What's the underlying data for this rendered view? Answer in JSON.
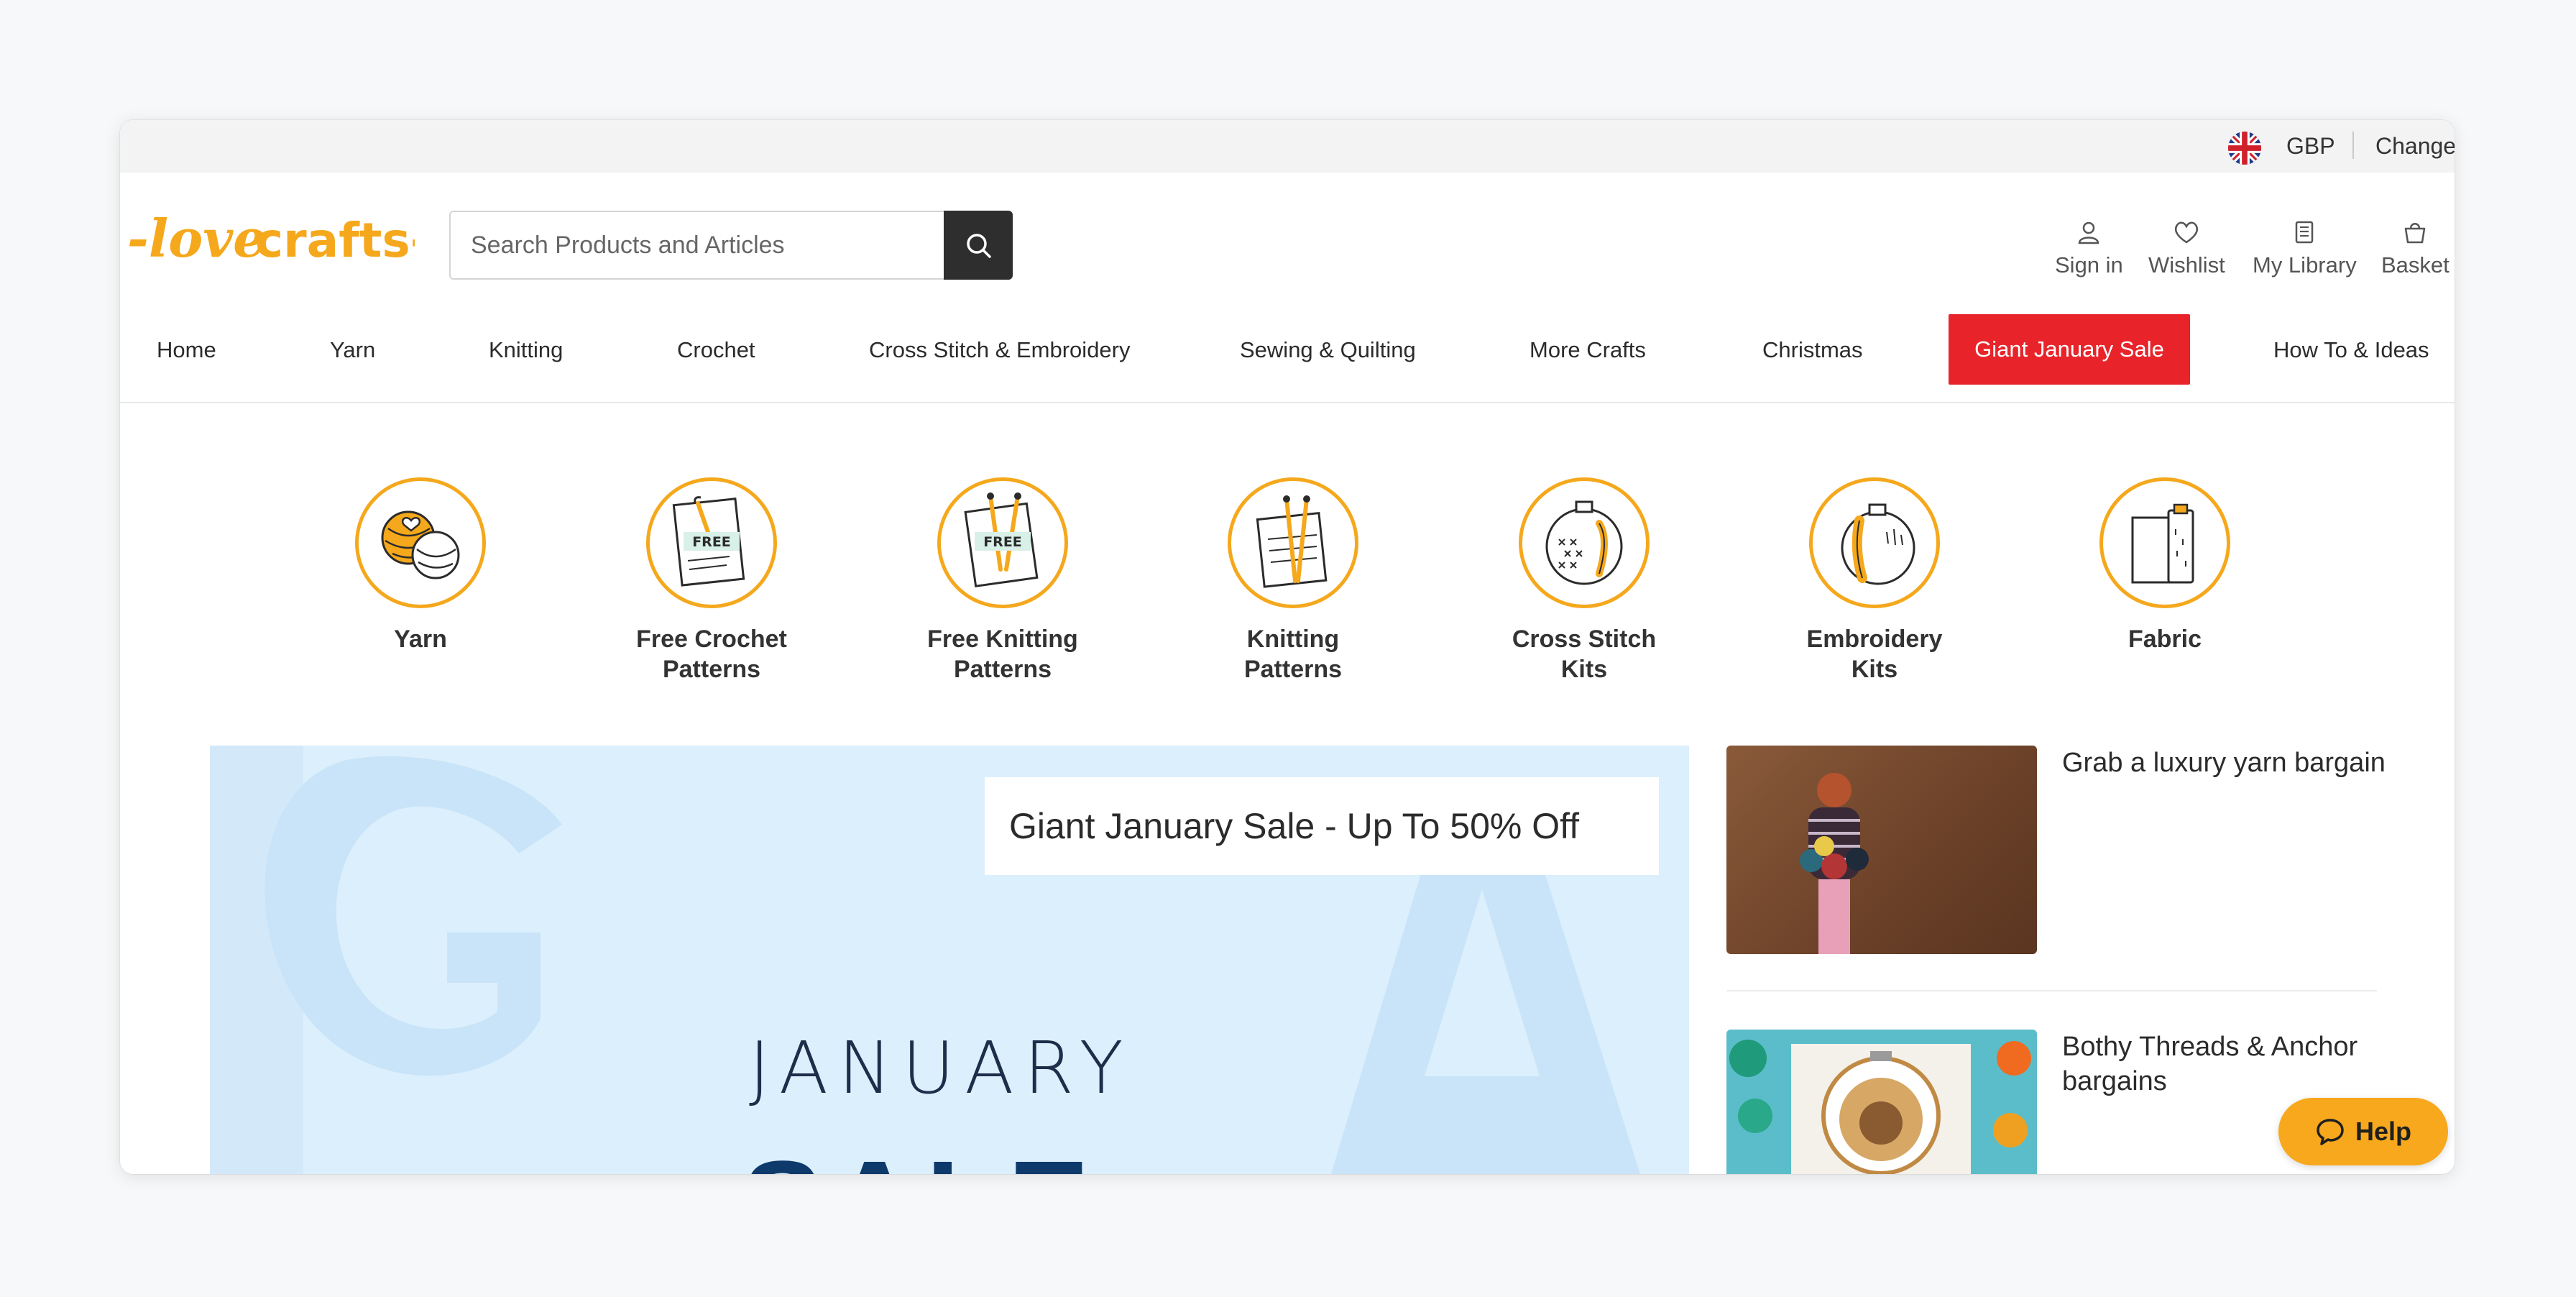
{
  "topbar": {
    "currency": "GBP",
    "change_label": "Change"
  },
  "logo": {
    "text": "-lovecrafts-"
  },
  "search": {
    "placeholder": "Search Products and Articles"
  },
  "header_actions": [
    {
      "label": "Sign in",
      "icon": "user-icon"
    },
    {
      "label": "Wishlist",
      "icon": "heart-icon"
    },
    {
      "label": "My Library",
      "icon": "library-icon"
    },
    {
      "label": "Basket",
      "icon": "basket-icon"
    }
  ],
  "nav": {
    "items": [
      "Home",
      "Yarn",
      "Knitting",
      "Crochet",
      "Cross Stitch & Embroidery",
      "Sewing & Quilting",
      "More Crafts",
      "Christmas",
      "Giant January Sale",
      "How To & Ideas"
    ]
  },
  "categories": [
    {
      "line1": "Yarn",
      "line2": ""
    },
    {
      "line1": "Free Crochet",
      "line2": "Patterns",
      "badge": "FREE"
    },
    {
      "line1": "Free Knitting",
      "line2": "Patterns",
      "badge": "FREE"
    },
    {
      "line1": "Knitting",
      "line2": "Patterns"
    },
    {
      "line1": "Cross Stitch",
      "line2": "Kits"
    },
    {
      "line1": "Embroidery",
      "line2": "Kits"
    },
    {
      "line1": "Fabric",
      "line2": ""
    }
  ],
  "hero": {
    "title": "Giant January Sale - Up To 50% Off",
    "line1": "JANUARY",
    "line2": "SALE"
  },
  "promos": [
    {
      "text": "Grab a luxury yarn bargain"
    },
    {
      "text": "Bothy Threads & Anchor bargains"
    }
  ],
  "help": {
    "label": "Help"
  },
  "colors": {
    "brand": "#f5a81c",
    "sale": "#e8242a",
    "hero_bg": "#dceffc",
    "dark": "#2e2e2e"
  }
}
